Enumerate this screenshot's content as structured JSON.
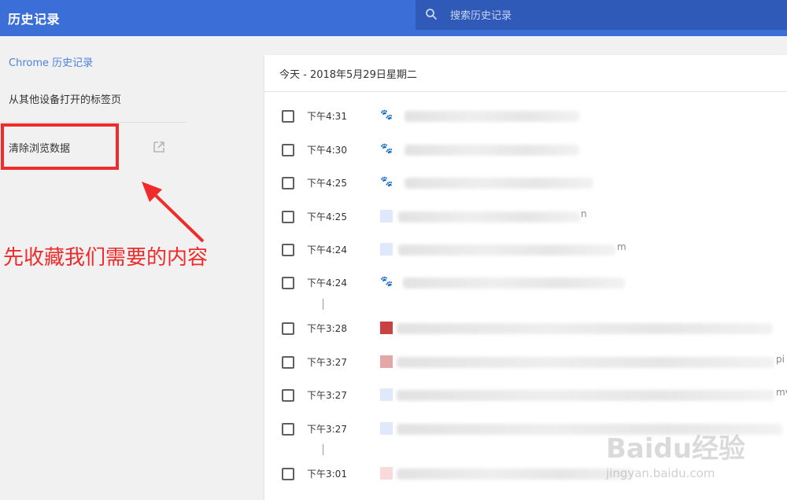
{
  "app": {
    "title": "历史记录"
  },
  "search": {
    "placeholder": "搜索历史记录"
  },
  "sidebar": {
    "items": [
      {
        "label": "Chrome 历史记录",
        "active": true
      },
      {
        "label": "从其他设备打开的标签页"
      },
      {
        "label": "清除浏览数据"
      }
    ]
  },
  "main": {
    "date_header": "今天 - 2018年5月29日星期二",
    "rows": [
      {
        "time": "下午4:31",
        "favicon": "baidu-paw-icon"
      },
      {
        "time": "下午4:30",
        "favicon": "baidu-paw-icon"
      },
      {
        "time": "下午4:25",
        "favicon": "baidu-paw-icon"
      },
      {
        "time": "下午4:25",
        "favicon": "light-blue-icon",
        "tail": "n"
      },
      {
        "time": "下午4:24",
        "favicon": "light-blue-icon",
        "tail": "m"
      },
      {
        "time": "下午4:24",
        "favicon": "baidu-paw-icon"
      },
      {
        "time": "下午3:28",
        "favicon": "red-site-icon"
      },
      {
        "time": "下午3:27",
        "favicon": "pink-site-icon",
        "tail": "pi"
      },
      {
        "time": "下午3:27",
        "favicon": "light-blue-icon",
        "tail": "mv"
      },
      {
        "time": "下午3:27",
        "favicon": "light-blue-icon"
      },
      {
        "time": "下午3:01",
        "favicon": "light-pink-icon"
      }
    ]
  },
  "annotation": {
    "text": "先收藏我们需要的内容"
  },
  "watermark": {
    "text": "Baidu经验",
    "sub": "jingyan.baidu.com"
  },
  "colors": {
    "topbar": "#3b6fd7",
    "search_bg": "#2f5ab8",
    "accent": "#4c82e0",
    "annotation": "#ef2b2b"
  }
}
